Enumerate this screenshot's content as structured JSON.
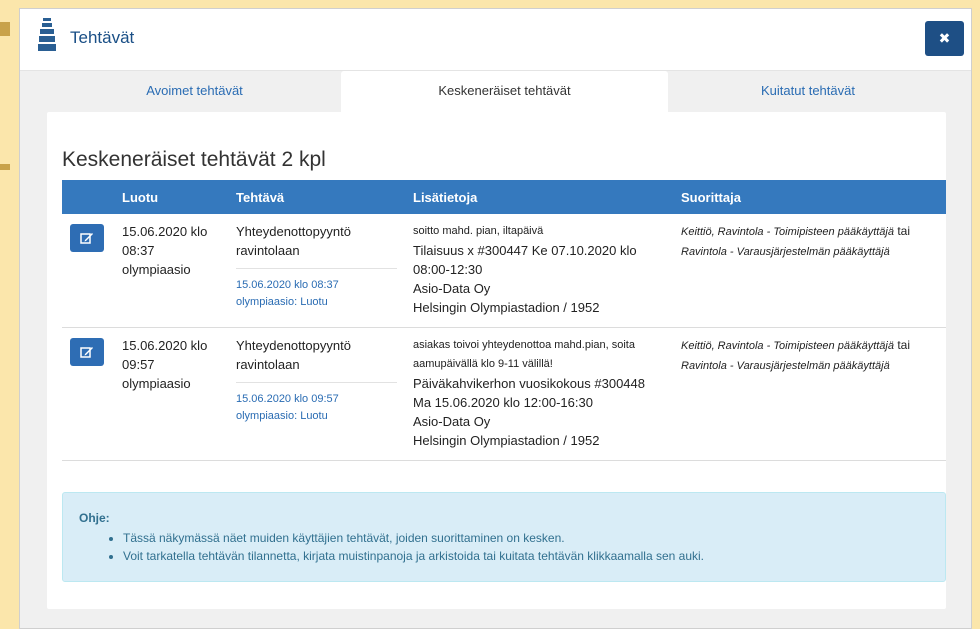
{
  "window": {
    "title": "Tehtävät",
    "close_label": "✖"
  },
  "tabs": [
    {
      "label": "Avoimet tehtävät",
      "active": false
    },
    {
      "label": "Keskeneräiset tehtävät",
      "active": true
    },
    {
      "label": "Kuitatut tehtävät",
      "active": false
    }
  ],
  "panel": {
    "title": "Keskeneräiset tehtävät 2 kpl",
    "columns": [
      "Luotu",
      "Tehtävä",
      "Lisätietoja",
      "Suorittaja"
    ],
    "rows": [
      {
        "created": [
          "15.06.2020 klo",
          "08:37",
          "olympiaasio"
        ],
        "task_title": "Yhteydenottopyyntö ravintolaan",
        "task_meta": [
          "15.06.2020 klo 08:37",
          "olympiaasio: Luotu"
        ],
        "info_small": [
          "soitto mahd. pian, iltapäivä"
        ],
        "info_lines": [
          "Tilaisuus x #300447 Ke 07.10.2020 klo 08:00-12:30",
          "Asio-Data Oy",
          "Helsingin Olympiastadion / 1952"
        ],
        "performer_a": "Keittiö, Ravintola - Toimipisteen pääkäyttäjä",
        "performer_or": "tai",
        "performer_b": "Ravintola - Varausjärjestelmän pääkäyttäjä"
      },
      {
        "created": [
          "15.06.2020 klo",
          "09:57",
          "olympiaasio"
        ],
        "task_title": "Yhteydenottopyyntö ravintolaan",
        "task_meta": [
          "15.06.2020 klo 09:57",
          "olympiaasio: Luotu"
        ],
        "info_small": [
          "asiakas toivoi yhteydenottoa mahd.pian, soita",
          "aamupäivällä klo 9-11 välillä!"
        ],
        "info_lines": [
          "Päiväkahvikerhon vuosikokous #300448",
          "Ma 15.06.2020 klo 12:00-16:30",
          "Asio-Data Oy",
          "Helsingin Olympiastadion / 1952"
        ],
        "performer_a": "Keittiö, Ravintola - Toimipisteen pääkäyttäjä",
        "performer_or": "tai",
        "performer_b": "Ravintola - Varausjärjestelmän pääkäyttäjä"
      }
    ]
  },
  "help": {
    "title": "Ohje:",
    "items": [
      "Tässä näkymässä näet muiden käyttäjien tehtävät, joiden suorittaminen on kesken.",
      "Voit tarkatella tehtävän tilannetta, kirjata muistinpanoja ja arkistoida tai kuitata tehtävän klikkaamalla sen auki."
    ]
  },
  "colors": {
    "accent": "#3579be",
    "header_btn": "#1e4f85",
    "help_bg": "#d9edf7",
    "page_bg": "#fbe6ab"
  }
}
